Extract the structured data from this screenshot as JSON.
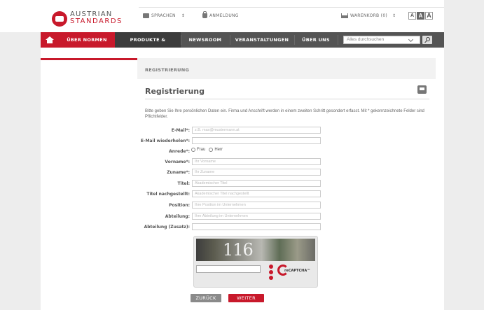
{
  "brand": {
    "line1": "AUSTRIAN",
    "line2": "STANDARDS",
    "accent": "#c8192b",
    "nav_bg": "#545454"
  },
  "topbar": {
    "languages": "SPRACHEN",
    "languages_caret": "↕",
    "login": "ANMELDUNG",
    "cart": "WARENKORB (0)",
    "cart_caret": "↕",
    "font_sizes": [
      "A",
      "A",
      "A"
    ]
  },
  "nav": {
    "items": [
      "ÜBER NORMEN",
      "PRODUKTE & LEISTUNGEN",
      "NEWSROOM",
      "VERANSTALTUNGEN",
      "ÜBER UNS"
    ],
    "search_placeholder": "Alles durchsuchen"
  },
  "breadcrumb": "REGISTRIERUNG",
  "title": "Registrierung",
  "intro": "Bitte geben Sie Ihre persönlichen Daten ein. Firma und Anschrift werden in einem zweiten Schritt gesondert erfasst. Mit * gekennzeichnete Felder sind Pflichtfelder.",
  "form": {
    "email_label": "E-Mail*:",
    "email_placeholder": "z.B. max@mustermann.at",
    "email_repeat_label": "E-Mail wiederholen*:",
    "salutation_label": "Anrede*:",
    "salutation_frau": "Frau",
    "salutation_herr": "Herr",
    "firstname_label": "Vorname*:",
    "firstname_placeholder": "Ihr Vorname",
    "lastname_label": "Zuname*:",
    "lastname_placeholder": "Ihr Zuname",
    "title_label": "Titel:",
    "title_placeholder": "Akademischer Titel",
    "title_suffix_label": "Titel nachgestellt:",
    "title_suffix_placeholder": "Akademischer Titel nachgestellt",
    "position_label": "Position:",
    "position_placeholder": "Ihre Position im Unternehmen",
    "department_label": "Abteilung:",
    "department_placeholder": "Ihre Abteilung im Unternehmen",
    "department_extra_label": "Abteilung (Zusatz):"
  },
  "captcha": {
    "text": "116",
    "brand": "reCAPTCHA™"
  },
  "buttons": {
    "back": "ZURÜCK",
    "next": "WEITER"
  }
}
